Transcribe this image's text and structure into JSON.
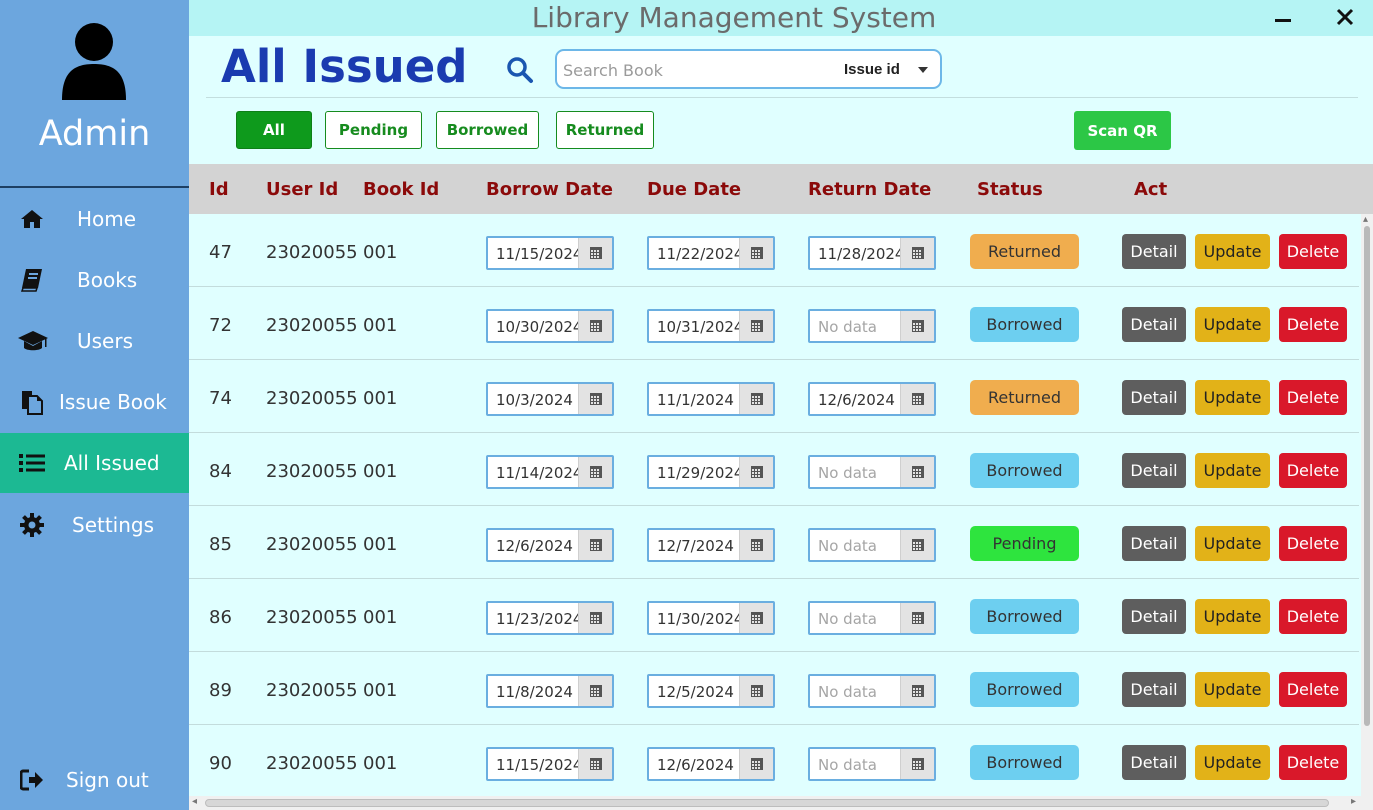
{
  "app_title": "Library Management System",
  "sidebar": {
    "user_name": "Admin",
    "items": [
      {
        "label": "Home",
        "icon": "home-icon"
      },
      {
        "label": "Books",
        "icon": "book-icon"
      },
      {
        "label": "Users",
        "icon": "graduation-cap-icon"
      },
      {
        "label": "Issue Book",
        "icon": "copy-icon"
      },
      {
        "label": "All Issued",
        "icon": "list-icon",
        "active": true
      },
      {
        "label": "Settings",
        "icon": "gear-icon"
      }
    ],
    "signout_label": "Sign out"
  },
  "page_title": "All Issued",
  "search": {
    "placeholder": "Search Book",
    "value": "",
    "filter_selected": "Issue id"
  },
  "filters": [
    "All",
    "Pending",
    "Borrowed",
    "Returned"
  ],
  "active_filter": "All",
  "scan_label": "Scan QR",
  "table": {
    "headers": [
      "Id",
      "User Id",
      "Book Id",
      "Borrow Date",
      "Due Date",
      "Return Date",
      "Status",
      "Act"
    ],
    "no_data_text": "No data",
    "action_labels": {
      "detail": "Detail",
      "update": "Update",
      "delete": "Delete"
    },
    "rows": [
      {
        "id": "47",
        "user_id": "23020055",
        "book_id": "001",
        "borrow_date": "11/15/2024",
        "due_date": "11/22/2024",
        "return_date": "11/28/2024",
        "status": "Returned"
      },
      {
        "id": "72",
        "user_id": "23020055",
        "book_id": "001",
        "borrow_date": "10/30/2024",
        "due_date": "10/31/2024",
        "return_date": "",
        "status": "Borrowed"
      },
      {
        "id": "74",
        "user_id": "23020055",
        "book_id": "001",
        "borrow_date": "10/3/2024",
        "due_date": "11/1/2024",
        "return_date": "12/6/2024",
        "status": "Returned"
      },
      {
        "id": "84",
        "user_id": "23020055",
        "book_id": "001",
        "borrow_date": "11/14/2024",
        "due_date": "11/29/2024",
        "return_date": "",
        "status": "Borrowed"
      },
      {
        "id": "85",
        "user_id": "23020055",
        "book_id": "001",
        "borrow_date": "12/6/2024",
        "due_date": "12/7/2024",
        "return_date": "",
        "status": "Pending"
      },
      {
        "id": "86",
        "user_id": "23020055",
        "book_id": "001",
        "borrow_date": "11/23/2024",
        "due_date": "11/30/2024",
        "return_date": "",
        "status": "Borrowed"
      },
      {
        "id": "89",
        "user_id": "23020055",
        "book_id": "001",
        "borrow_date": "11/8/2024",
        "due_date": "12/5/2024",
        "return_date": "",
        "status": "Borrowed"
      },
      {
        "id": "90",
        "user_id": "23020055",
        "book_id": "001",
        "borrow_date": "11/15/2024",
        "due_date": "12/6/2024",
        "return_date": "",
        "status": "Borrowed"
      }
    ]
  },
  "status_colors": {
    "Returned": "#f0ad4e",
    "Borrowed": "#6dcff0",
    "Pending": "#2ee43e"
  },
  "colors": {
    "sidebar": "#6ca6de",
    "active_nav": "#1cb993",
    "title": "#1a3bb0",
    "header_text": "#8b0a0a"
  }
}
